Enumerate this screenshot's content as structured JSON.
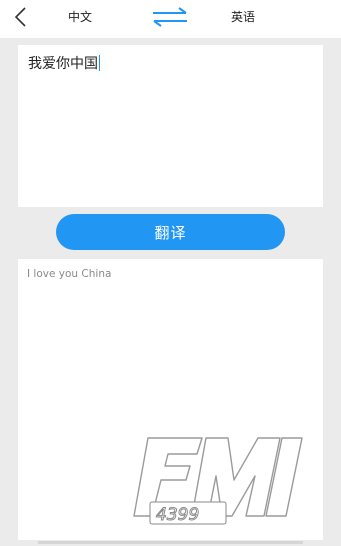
{
  "header": {
    "source_language": "中文",
    "target_language": "英语",
    "back_icon": "chevron-left-icon",
    "swap_icon": "swap-arrows-icon",
    "accent_color": "#2196f3"
  },
  "input": {
    "text": "我爱你中国"
  },
  "translate_button": {
    "label": "翻译"
  },
  "output": {
    "text": "I love you China"
  },
  "watermark": {
    "text": "FM 4399"
  }
}
